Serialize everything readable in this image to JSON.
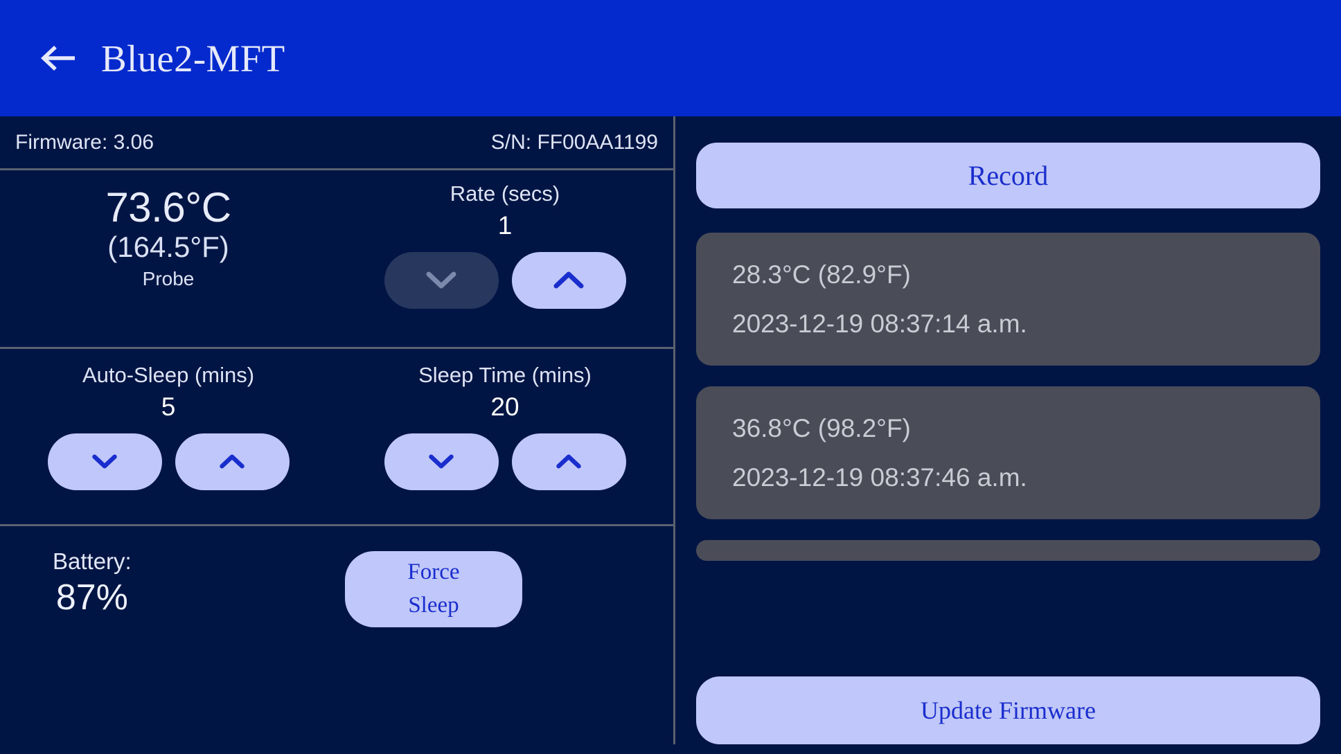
{
  "colors": {
    "header_blue": "#0429cc",
    "background_navy": "#001544",
    "button_lavender": "#c0c7fb",
    "button_text_blue": "#1a2ecd",
    "disabled_button": "#27375e",
    "record_card_gray": "#4a4c57",
    "divider_gray": "#5c6170"
  },
  "header": {
    "back_icon": "arrow-left-icon",
    "title": "Blue2-MFT"
  },
  "device_info": {
    "firmware": "Firmware: 3.06",
    "serial": "S/N: FF00AA1199"
  },
  "temperature": {
    "celsius": "73.6°C",
    "fahrenheit": "(164.5°F)",
    "source_label": "Probe"
  },
  "rate": {
    "title": "Rate (secs)",
    "value": "1",
    "down_icon": "chevron-down-icon",
    "up_icon": "chevron-up-icon",
    "down_enabled": false,
    "up_enabled": true
  },
  "auto_sleep": {
    "title": "Auto-Sleep (mins)",
    "value": "5",
    "down_icon": "chevron-down-icon",
    "up_icon": "chevron-up-icon"
  },
  "sleep_time": {
    "title": "Sleep Time (mins)",
    "value": "20",
    "down_icon": "chevron-down-icon",
    "up_icon": "chevron-up-icon"
  },
  "battery": {
    "label": "Battery:",
    "value": "87%"
  },
  "force_sleep": {
    "line1": "Force",
    "line2": "Sleep"
  },
  "right_panel": {
    "record_button": "Record",
    "update_firmware_button": "Update Firmware",
    "records": [
      {
        "temperature": "28.3°C (82.9°F)",
        "timestamp": "2023-12-19 08:37:14 a.m."
      },
      {
        "temperature": "36.8°C (98.2°F)",
        "timestamp": "2023-12-19 08:37:46 a.m."
      }
    ]
  }
}
